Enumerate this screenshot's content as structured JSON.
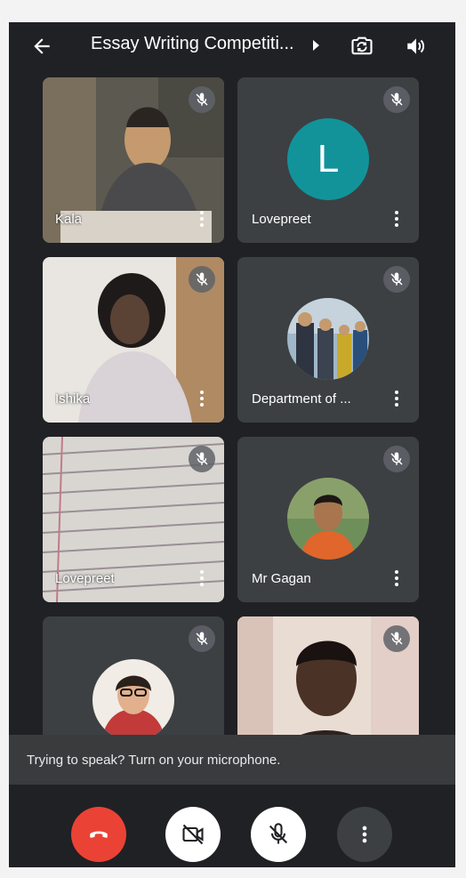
{
  "header": {
    "title": "Essay Writing Competiti...",
    "back_icon": "arrow-back-icon",
    "switch_camera_icon": "switch-camera-icon",
    "audio_icon": "speaker-icon"
  },
  "participants": [
    {
      "name": "Kala",
      "muted": true,
      "type": "video"
    },
    {
      "name": "Lovepreet",
      "muted": true,
      "type": "avatar-letter",
      "initial": "L",
      "avatar_color": "#12939a"
    },
    {
      "name": "Ishika",
      "muted": true,
      "type": "video"
    },
    {
      "name": "Department of ...",
      "muted": true,
      "type": "avatar-photo"
    },
    {
      "name": "Lovepreet",
      "muted": true,
      "type": "video"
    },
    {
      "name": "Mr Gagan",
      "muted": true,
      "type": "avatar-photo"
    },
    {
      "name": "",
      "muted": true,
      "type": "avatar-photo"
    },
    {
      "name": "",
      "muted": true,
      "type": "video"
    }
  ],
  "banner": {
    "text": "Trying to speak? Turn on your microphone."
  },
  "controls": {
    "end_call_color": "#ea4335",
    "end_call_icon": "hang-up-icon",
    "camera_icon": "camera-off-icon",
    "mic_icon": "mic-off-icon",
    "more_icon": "more-vert-icon"
  },
  "colors": {
    "background": "#202124",
    "tile": "#3c4043",
    "accent": "#12939a"
  }
}
